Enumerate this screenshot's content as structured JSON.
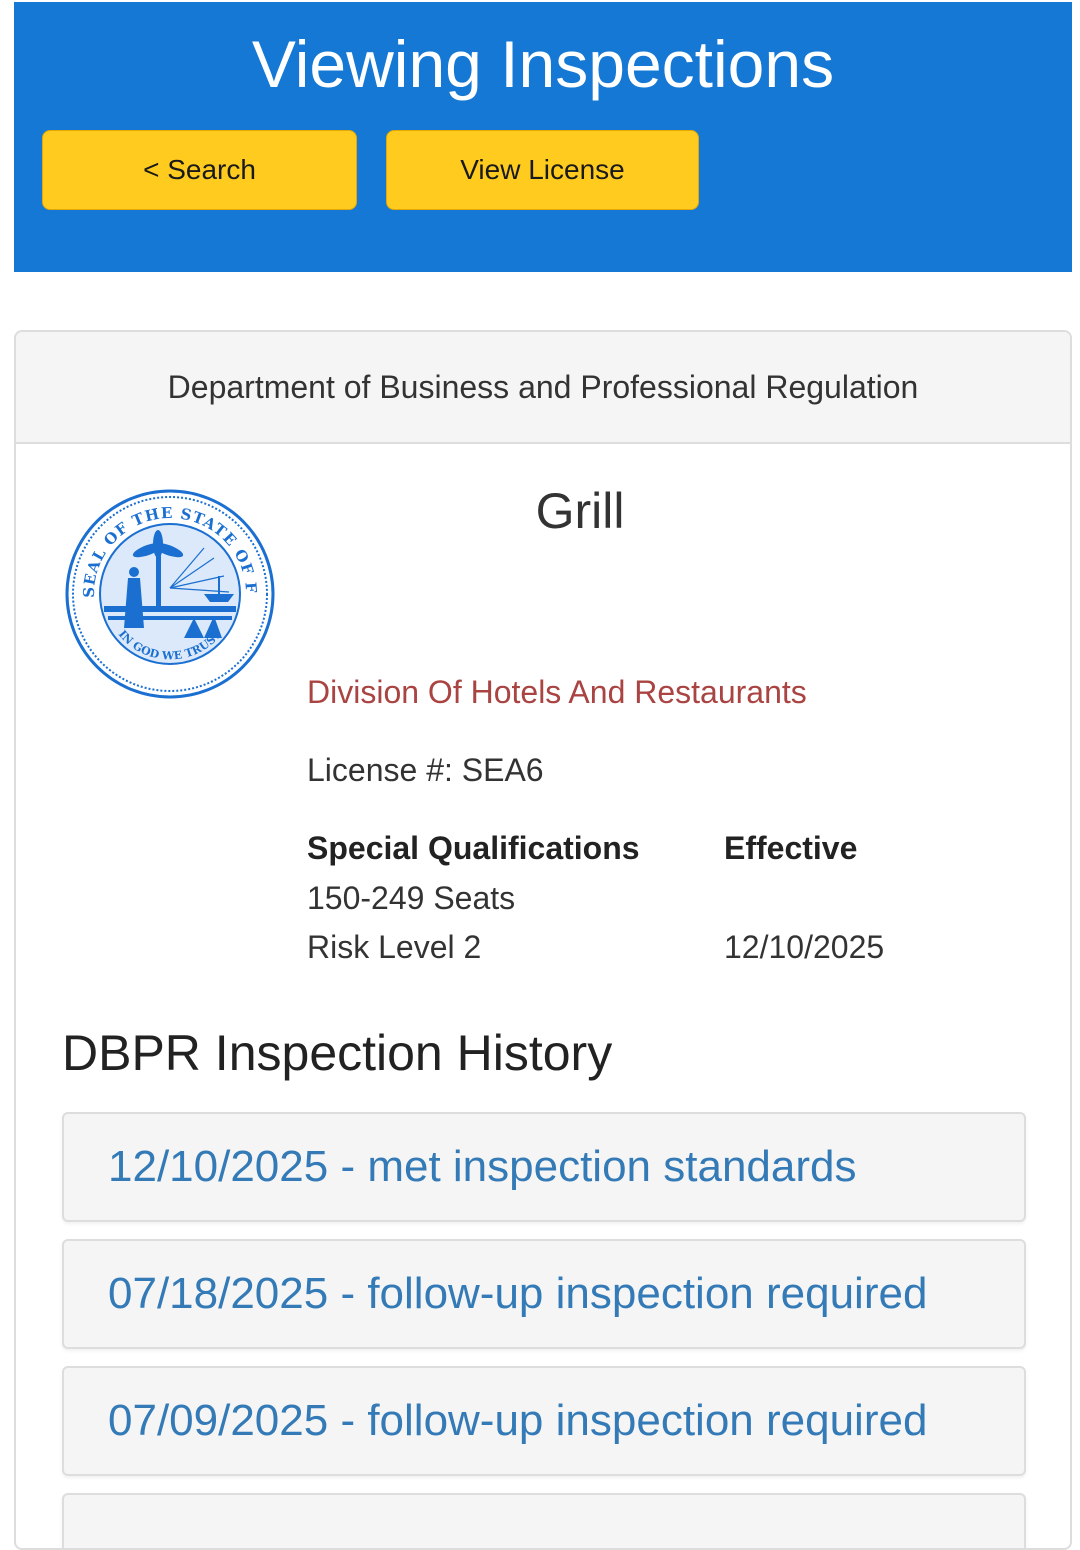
{
  "header": {
    "title": "Viewing Inspections",
    "search_button": "< Search",
    "view_license_button": "View License",
    "background": "#1478d4",
    "button_color": "#ffcb1f"
  },
  "panel": {
    "heading": "Department of Business and Professional Regulation",
    "seal_icon": "florida-state-seal",
    "seal_text_top": "GREAT SEAL OF THE STATE OF FLORIDA",
    "seal_text_bottom": "IN GOD WE TRUST",
    "business_name": "Grill",
    "division": "Division Of Hotels And Restaurants",
    "license": "License #: SEA6",
    "special_qualifications_label": "Special Qualifications",
    "effective_label": "Effective",
    "qualifications": [
      "150-249 Seats",
      "Risk Level 2"
    ],
    "effective_date": "12/10/2025"
  },
  "history": {
    "title": "DBPR Inspection History",
    "items": [
      "12/10/2025 - met inspection standards",
      "07/18/2025 - follow-up inspection required",
      "07/09/2025 - follow-up inspection required"
    ]
  }
}
